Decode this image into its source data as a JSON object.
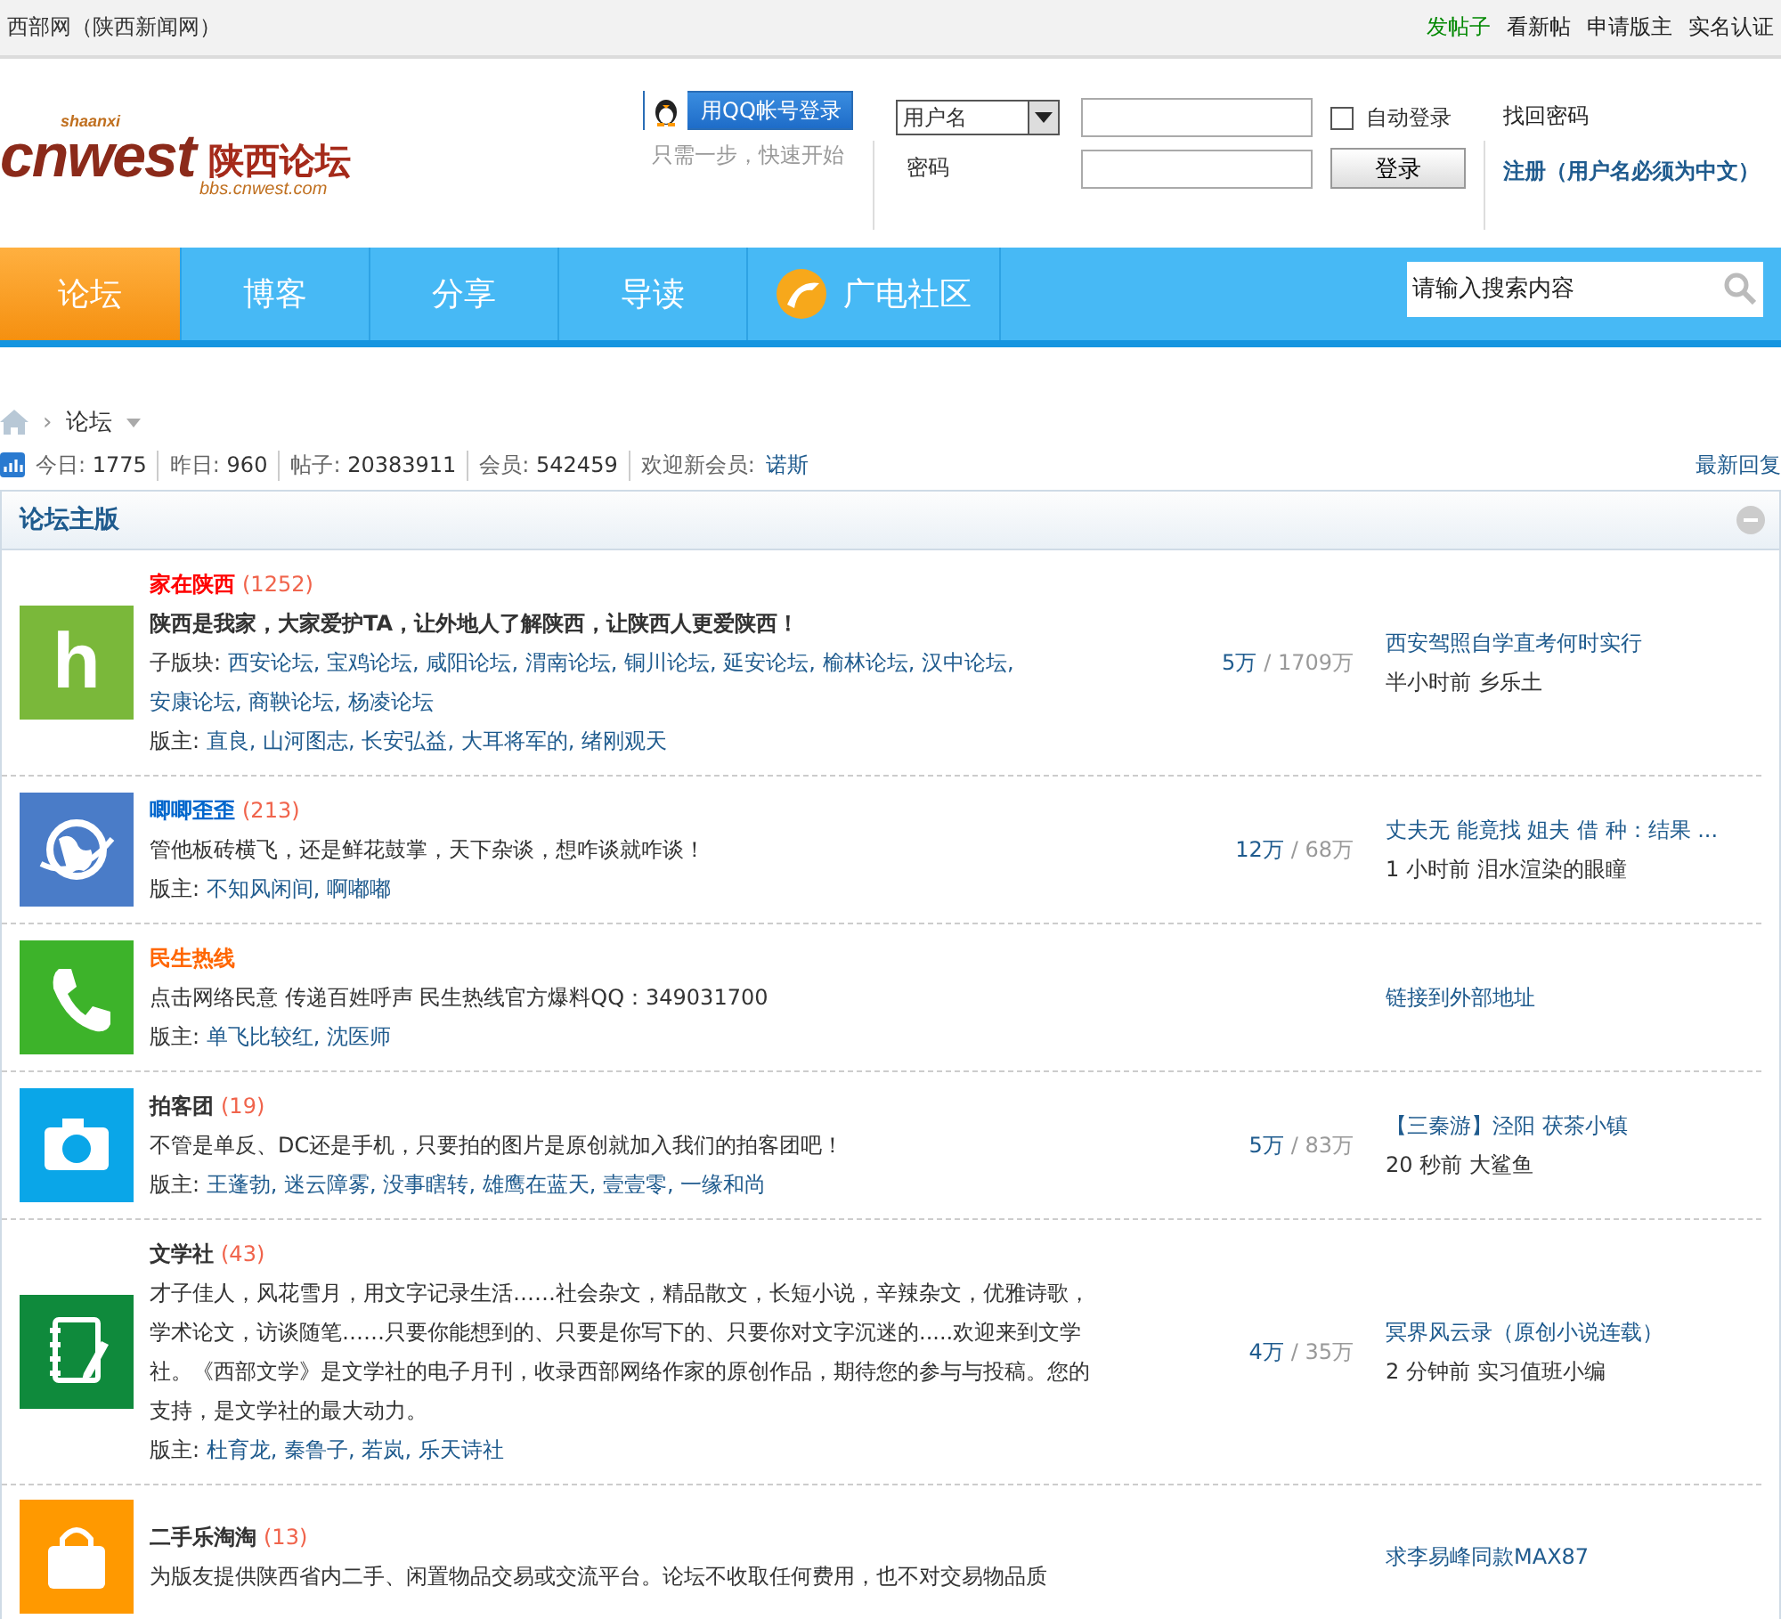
{
  "topbar": {
    "site": "西部网（陕西新闻网）",
    "links": [
      {
        "label": "发帖子",
        "kind": "primary"
      },
      {
        "label": "看新帖",
        "kind": "plain"
      },
      {
        "label": "申请版主",
        "kind": "plain"
      },
      {
        "label": "实名认证",
        "kind": "plain"
      }
    ]
  },
  "logo": {
    "brand": "cnwest",
    "small": "shaanxi",
    "name": "陕西论坛",
    "url": "bbs.cnwest.com"
  },
  "login": {
    "qq_button": "用QQ帐号登录",
    "qq_hint": "只需一步，快速开始",
    "account_type": "用户名",
    "password_label": "密码",
    "auto_login": {
      "label": "自动登录",
      "checked": false
    },
    "submit": "登录",
    "forgot": "找回密码",
    "register": "注册（用户名必须为中文）"
  },
  "nav": {
    "items": [
      {
        "label": "论坛",
        "selected": true,
        "kind": "plain"
      },
      {
        "label": "博客",
        "selected": false,
        "kind": "plain"
      },
      {
        "label": "分享",
        "selected": false,
        "kind": "plain"
      },
      {
        "label": "导读",
        "selected": false,
        "kind": "plain"
      },
      {
        "label": "广电社区",
        "selected": false,
        "kind": "logo"
      }
    ],
    "search": {
      "placeholder": "请输入搜索内容"
    }
  },
  "breadcrumb": {
    "sep": "›",
    "current": "论坛"
  },
  "stats": {
    "items": [
      {
        "label": "今日:",
        "value": "1775"
      },
      {
        "label": "昨日:",
        "value": "960"
      },
      {
        "label": "帖子:",
        "value": "20383911"
      },
      {
        "label": "会员:",
        "value": "542459"
      }
    ],
    "welcome": "欢迎新会员:",
    "new_member": "诺斯",
    "latest": "最新回复"
  },
  "panel": {
    "title": "论坛主版",
    "list_sep": ",",
    "forums": [
      {
        "name": "家在陕西",
        "color": "#ff0000",
        "count": "(1252)",
        "icon": {
          "kind": "letter",
          "glyph": "h",
          "color": "#7ab83a"
        },
        "desc": "陕西是我家，大家爱护TA，让外地人了解陕西，让陕西人更爱陕西！",
        "desc_bold": true,
        "subforums_label": "子版块:",
        "subforums": [
          "西安论坛",
          "宝鸡论坛",
          "咸阳论坛",
          "渭南论坛",
          "铜川论坛",
          "延安论坛",
          "榆林论坛",
          "汉中论坛",
          "安康论坛",
          "商鞅论坛",
          "杨凌论坛"
        ],
        "mods_label": "版主:",
        "mods": [
          "直良",
          "山河图志",
          "长安弘益",
          "大耳将军的",
          "绪刚观天"
        ],
        "threads": "5万",
        "posts": "/ 1709万",
        "last": {
          "title": "西安驾照自学直考何时实行",
          "time": "半小时前",
          "user": "乡乐土"
        }
      },
      {
        "name": "唧唧歪歪",
        "color": "#0066cc",
        "count": "(213)",
        "icon": {
          "kind": "globe",
          "color": "#4a7cc8"
        },
        "desc": "管他板砖横飞，还是鲜花鼓掌，天下杂谈，想咋谈就咋谈！",
        "desc_bold": false,
        "mods_label": "版主:",
        "mods": [
          "不知风闲间",
          "啊嘟嘟"
        ],
        "threads": "12万",
        "posts": "/ 68万",
        "last": {
          "title": "丈夫无 能竟找 姐夫 借 种：结果 ...",
          "time": "1 小时前",
          "user": "泪水渲染的眼瞳"
        }
      },
      {
        "name": "民生热线",
        "color": "#ff6600",
        "icon": {
          "kind": "phone",
          "color": "#3db32a"
        },
        "desc": "点击网络民意  传递百姓呼声  民生热线官方爆料QQ：349031700",
        "desc_bold": false,
        "mods_label": "版主:",
        "mods": [
          "单飞比较红",
          "沈医师"
        ],
        "last": {
          "title": "链接到外部地址"
        }
      },
      {
        "name": "拍客团",
        "color": "#333333",
        "count": "(19)",
        "icon": {
          "kind": "camera",
          "color": "#0aa6e8"
        },
        "desc": "不管是单反、DC还是手机，只要拍的图片是原创就加入我们的拍客团吧！",
        "desc_bold": false,
        "mods_label": "版主:",
        "mods": [
          "王蓬勃",
          "迷云障雾",
          "没事瞎转",
          "雄鹰在蓝天",
          "壹壹零",
          "一缘和尚"
        ],
        "threads": "5万",
        "posts": "/ 83万",
        "last": {
          "title": "【三秦游】泾阳  茯茶小镇",
          "time": "20 秒前",
          "user": "大鲨鱼"
        }
      },
      {
        "name": "文学社",
        "color": "#333333",
        "count": "(43)",
        "icon": {
          "kind": "notebook",
          "color": "#0f8a3c"
        },
        "desc": "才子佳人，风花雪月，用文字记录生活……社会杂文，精品散文，长短小说，辛辣杂文，优雅诗歌，学术论文，访谈随笔……只要你能想到的、只要是你写下的、只要你对文字沉迷的.....欢迎来到文学社。《西部文学》是文学社的电子月刊，收录西部网络作家的原创作品，期待您的参与与投稿。您的支持，是文学社的最大动力。",
        "desc_bold": false,
        "mods_label": "版主:",
        "mods": [
          "杜育龙",
          "秦鲁子",
          "若岚",
          "乐天诗社"
        ],
        "threads": "4万",
        "posts": "/ 35万",
        "last": {
          "title": "冥界风云录（原创小说连载）",
          "time": "2 分钟前",
          "user": "实习值班小编"
        }
      },
      {
        "name": "二手乐淘淘",
        "color": "#333333",
        "count": "(13)",
        "icon": {
          "kind": "bag",
          "color": "#ff9900"
        },
        "desc": "为版友提供陕西省内二手、闲置物品交易或交流平台。论坛不收取任何费用，也不对交易物品质",
        "desc_bold": false,
        "last": {
          "title": "求李易峰同款MAX87"
        }
      }
    ]
  }
}
